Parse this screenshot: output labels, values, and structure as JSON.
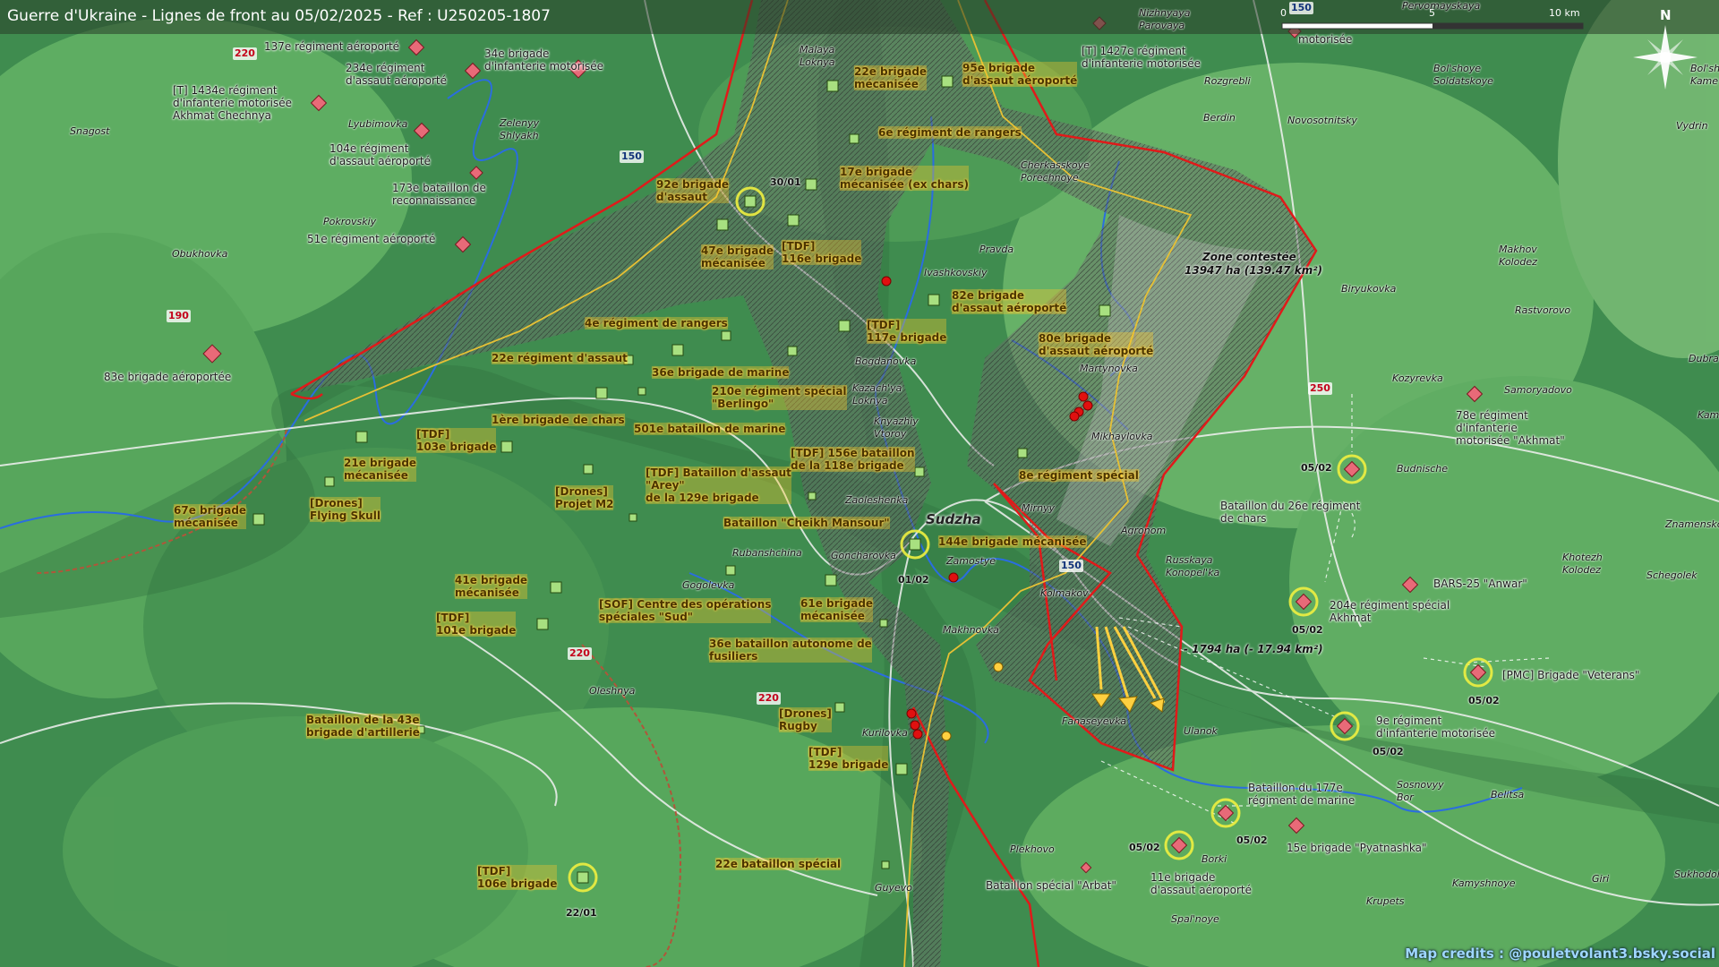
{
  "title": "Guerre d'Ukraine - Lignes de front au 05/02/2025 - Ref : U250205-1807",
  "credits": "Map credits : @pouletvolant3.bsky.social",
  "scale": {
    "zero": "0",
    "mid": "5",
    "max": "10 km"
  },
  "north": "N",
  "colors": {
    "russia_unit": "#e05a6a",
    "ukraine_unit": "#9ee07a",
    "front_line": "#e01a1a",
    "ukraine_line": "#e6c035",
    "contested": "#707070",
    "river": "#2a6de0",
    "arrow": "#ffd040"
  },
  "zone": {
    "contested_title": "Zone contestée",
    "contested_area": "13947 ha (139.47 km²)",
    "loss": "- 1794 ha (- 17.94 km²)"
  },
  "roads": {
    "r220a": "220",
    "r220b": "220",
    "r220c": "220",
    "r190": "190",
    "r150a": "150",
    "r150b": "150",
    "r150c": "150",
    "r250": "250"
  },
  "towns": {
    "sudzha": "Sudzha",
    "malaya_loknya": "Malaya\nLoknya",
    "nizhnyaya": "Nizhnyaya\nParovaya",
    "pervomayskaya": "Pervomayskaya",
    "rozgrebli": "Rozgrebli",
    "bolshoye": "Bol'shoye\nSoldatskoye",
    "bolshoye_kamen": "Bol'sh\nKame",
    "berdin": "Berdin",
    "novosotnitsky": "Novosotnitsky",
    "vydrin": "Vydrin",
    "snagost": "Snagost",
    "lyubimovka": "Lyubimovka",
    "zelenyy": "Zelenyy\nShlyakh",
    "cherkasskoye": "Cherkasskoye\nPorechnoye",
    "pokrovskiy": "Pokrovskiy",
    "obukhovka": "Obukhovka",
    "ivashkovskiy": "Ivashkovskiy",
    "pravda": "Pravda",
    "makhov": "Makhov\nKolodez",
    "rastvorovo": "Rastvorovo",
    "biryukovka": "Biryukovka",
    "kozyrevka": "Kozyrevka",
    "samoryadovo": "Samoryadovo",
    "dubrava": "Dubrav",
    "kam": "Kam",
    "martynovka": "Martynovka",
    "bogdanovka": "Bogdanovka",
    "kazachya": "Kazach'ya\nLoknya",
    "knyazhiy": "Knyazhiy\nVtoroy",
    "mikhaylovka": "Mikhaylovka",
    "budnische": "Budnische",
    "zaoleshenka": "Zaoleshenka",
    "mirnyy": "Mirnyy",
    "agronom": "Agronom",
    "znamenskoye": "Znamensko",
    "rubanshchina": "Rubanshchina",
    "goncharovka": "Goncharovka",
    "zamostye": "Zamostye",
    "russkaya": "Russkaya\nKonopel'ka",
    "khotezh": "Khotezh\nKolodez",
    "schegolek": "Schegolek",
    "gogolevka": "Gogolevka",
    "kolmakov": "Kolmakov",
    "makhnovka": "Makhnovka",
    "oleshnya": "Oleshnya",
    "fanaseyevka": "Fanaseyevka",
    "ulanok": "Ulanok",
    "kurilovka": "Kurilovka",
    "sosnovyy": "Sosnovyy\nBor",
    "belitsa": "Belitsa",
    "plekhovo": "Plekhovo",
    "borki": "Borki",
    "spalnoye": "Spal'noye",
    "kamyshnoye": "Kamyshnoye",
    "giri": "Giri",
    "krupets": "Krupets",
    "sukhodol": "Sukhodol",
    "guyevo": "Guyevo"
  },
  "russian_units": {
    "r137": "137e régiment aéroporté",
    "r34": "34e brigade\nd'infanterie motorisée",
    "r234": "234e régiment\nd'assaut aéroporté",
    "r1434": "[T] 1434e régiment\nd'infanterie motorisée\nAkhmat Chechnya",
    "r104": "104e régiment\nd'assaut aéroporté",
    "r173": "173e bataillon de\nreconnaissance",
    "r51": "51e régiment aéroporté",
    "r83": "83e brigade aéroportée",
    "r1427": "[T] 1427e régiment\nd'infanterie motorisée",
    "r_motorisee": "motorisée",
    "r78": "78e régiment\nd'infanterie\nmotorisée \"Akhmat\"",
    "r26": "Bataillon du 26e régiment\nde chars",
    "rbars": "BARS-25 \"Anwar\"",
    "r204": "204e régiment spécial\nAkhmat",
    "rpmc": "[PMC] Brigade \"Veterans\"",
    "r9": "9e régiment\nd'infanterie motorisée",
    "r177": "Bataillon du 177e\nrégiment de marine",
    "r15": "15e brigade \"Pyatnashka\"",
    "r11": "11e brigade\nd'assaut aéroporté",
    "rarbat": "Bataillon spécial \"Arbat\""
  },
  "ukrainian_units": {
    "u22": "22e brigade\nmécanisée",
    "u95": "95e brigade\nd'assaut aéroporté",
    "u6r": "6e régiment de rangers",
    "u17": "17e brigade\nmécanisée (ex chars)",
    "u92": "92e brigade\nd'assaut",
    "u47": "47e brigade\nmécanisée",
    "u116": "[TDF]\n116e brigade",
    "u82": "82e brigade\nd'assaut aéroporté",
    "u117": "[TDF]\n117e brigade",
    "u80": "80e brigade\nd'assaut aéroporté",
    "u4r": "4e régiment de rangers",
    "u22r": "22e régiment d'assaut",
    "u36m": "36e brigade de marine",
    "u210": "210e régiment spécial\n\"Berlingo\"",
    "u1ch": "1ère brigade de chars",
    "u501": "501e bataillon de marine",
    "u103": "[TDF]\n103e brigade",
    "u21": "21e brigade\nmécanisée",
    "u156": "[TDF] 156e bataillon\nde la 118e brigade",
    "u8": "8e régiment spécial",
    "uarey": "[TDF] Bataillon d'assaut\n\"Arey\"\nde la 129e brigade",
    "udm2": "[Drones]\nProjet M2",
    "uflying": "[Drones]\nFlying Skull",
    "u67": "67e brigade\nmécanisée",
    "ucheikh": "Bataillon \"Cheikh Mansour\"",
    "u144": "144e brigade mécanisée",
    "u41": "41e brigade\nmécanisée",
    "usof": "[SOF] Centre des opérations\nspéciales \"Sud\"",
    "u61": "61e brigade\nmécanisée",
    "u101": "[TDF]\n101e brigade",
    "u36b": "36e bataillon autonome de\nfusiliers",
    "u43": "Bataillon de la 43e\nbrigade d'artillerie",
    "urugby": "[Drones]\nRugby",
    "u129": "[TDF]\n129e brigade",
    "u22s": "22e bataillon spécial",
    "u106": "[TDF]\n106e brigade"
  },
  "dates": {
    "d3001": "30/01",
    "d0102": "01/02",
    "d2201": "22/01",
    "d0502a": "05/02",
    "d0502b": "05/02",
    "d0502c": "05/02",
    "d0502d": "05/02",
    "d0502e": "05/02",
    "d0502f": "05/02"
  },
  "icons": {
    "russian": "red-diamond-unit-icon",
    "ukrainian": "green-square-unit-icon",
    "north": "compass-star-icon"
  }
}
